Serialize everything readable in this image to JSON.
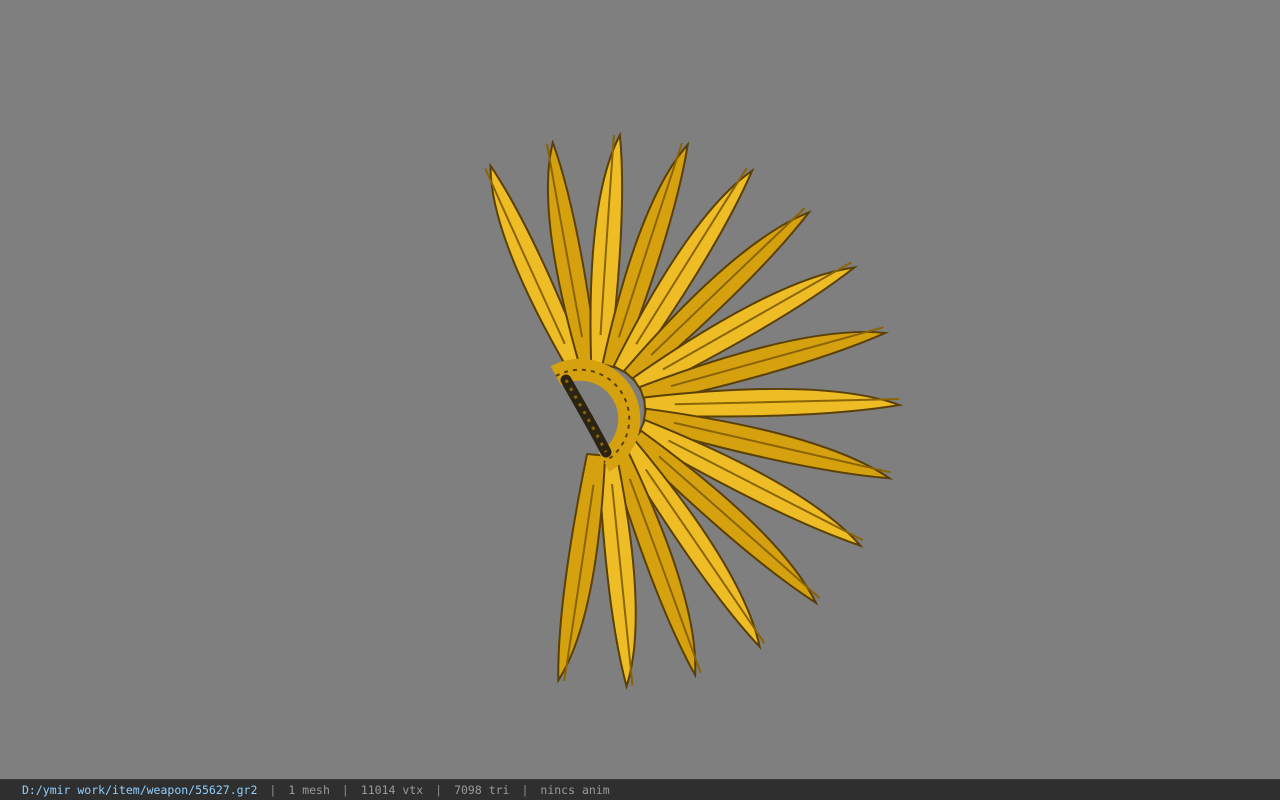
{
  "viewport": {
    "background_color": "#7f7f7f",
    "model": {
      "name": "fan-weapon-model",
      "colors": {
        "gold": "#d6a10e",
        "gold_light": "#eebd25",
        "gold_dark": "#8a6405",
        "outline": "#5a4004",
        "handle": "#2b2414"
      }
    }
  },
  "statusbar": {
    "path": "D:/ymir work/item/weapon/55627.gr2",
    "separator": "|",
    "mesh": "1 mesh",
    "vertices": "11014 vtx",
    "triangles": "7098 tri",
    "anim": "nincs anim"
  }
}
